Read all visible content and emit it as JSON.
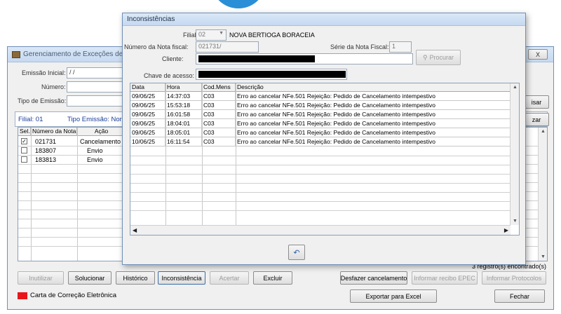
{
  "bg_window": {
    "title": "Gerenciamento de Exceções de N",
    "close_label": "X",
    "emissao_inicial_label": "Emissão Inicial:",
    "emissao_inicial_value": " / /",
    "numero_label": "Número:",
    "tipo_emissao_label": "Tipo de Emissão:",
    "filial_text": "Filial: 01",
    "tipo_emissao_text": "Tipo Emissão: Norm",
    "right_btn_1": "isar",
    "right_btn_2": "zar",
    "columns": [
      "Sel.",
      "Número da Nota",
      "Ação"
    ],
    "rows": [
      {
        "checked": "✓",
        "numero": "021731",
        "acao": "Cancelamento"
      },
      {
        "checked": "",
        "numero": "183807",
        "acao": "Envio"
      },
      {
        "checked": "",
        "numero": "183813",
        "acao": "Envio"
      }
    ],
    "records_found": "3 registro(s) encontrado(s)",
    "buttons": {
      "inutilizar": "Inutilizar",
      "solucionar": "Solucionar",
      "historico": "Histórico",
      "inconsistencia": "Inconsistência",
      "acertar": "Acertar",
      "excluir": "Excluir",
      "desfazer": "Desfazer cancelamento",
      "informar_recibo": "Informar recibo EPEC",
      "informar_protocolos": "Informar Protocolos",
      "exportar": "Exportar para Excel",
      "fechar": "Fechar"
    },
    "legend_label": "Carta de Correção Eletrônica",
    "legend_color": "#e8161b"
  },
  "dialog": {
    "title": "Inconsistências",
    "filial_label": "Filial:",
    "filial_code": "02",
    "filial_name": "NOVA BERTIOGA BORACEIA",
    "numero_nota_label": "Número da Nota fiscal:",
    "numero_nota_value": "021731/",
    "serie_label": "Série da Nota Fiscal:",
    "serie_value": "1",
    "cliente_label": "Cliente:",
    "procurar_label": "Procurar",
    "chave_label": "Chave de acesso:",
    "columns": [
      "Data",
      "Hora",
      "Cod.Mens",
      "Descrição"
    ],
    "rows": [
      {
        "data": "09/06/25",
        "hora": "14:37:03",
        "cod": "C03",
        "desc": "Erro ao cancelar NFe.501 Rejeição: Pedido de Cancelamento intempestivo"
      },
      {
        "data": "09/06/25",
        "hora": "15:53:18",
        "cod": "C03",
        "desc": "Erro ao cancelar NFe.501 Rejeição: Pedido de Cancelamento intempestivo"
      },
      {
        "data": "09/06/25",
        "hora": "16:01:58",
        "cod": "C03",
        "desc": "Erro ao cancelar NFe.501 Rejeição: Pedido de Cancelamento intempestivo"
      },
      {
        "data": "09/06/25",
        "hora": "18:04:01",
        "cod": "C03",
        "desc": "Erro ao cancelar NFe.501 Rejeição: Pedido de Cancelamento intempestivo"
      },
      {
        "data": "09/06/25",
        "hora": "18:05:01",
        "cod": "C03",
        "desc": "Erro ao cancelar NFe.501 Rejeição: Pedido de Cancelamento intempestivo"
      },
      {
        "data": "10/06/25",
        "hora": "16:11:54",
        "cod": "C03",
        "desc": "Erro ao cancelar NFe.501 Rejeição: Pedido de Cancelamento intempestivo"
      }
    ],
    "accent_color": "#2a8fd6"
  }
}
